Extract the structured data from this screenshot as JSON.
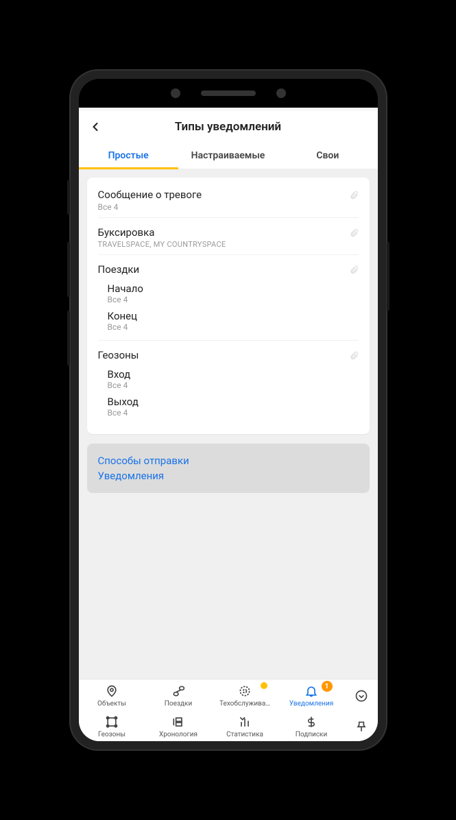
{
  "header": {
    "title": "Типы уведомлений"
  },
  "tabs": {
    "simple": "Простые",
    "custom": "Настраиваемые",
    "own": "Свои"
  },
  "list": {
    "alarm": {
      "title": "Сообщение о тревоге",
      "sub": "Все 4"
    },
    "towing": {
      "title": "Буксировка",
      "sub": "TRAVELSPACE, MY COUNTRYSPACE"
    },
    "trips": {
      "title": "Поездки",
      "start": {
        "title": "Начало",
        "count": "Все 4"
      },
      "end": {
        "title": "Конец",
        "count": "Все 4"
      }
    },
    "geo": {
      "title": "Геозоны",
      "enter": {
        "title": "Вход",
        "count": "Все 4"
      },
      "exit": {
        "title": "Выход",
        "count": "Все 4"
      }
    }
  },
  "links": {
    "delivery": "Способы отправки",
    "notifications": "Уведомления"
  },
  "nav": {
    "objects": "Объекты",
    "trips": "Поездки",
    "maintenance": "Техобслужива…",
    "notifications": "Уведомления",
    "geozones": "Геозоны",
    "timeline": "Хронология",
    "stats": "Статистика",
    "subs": "Подписки",
    "badge": "1"
  }
}
